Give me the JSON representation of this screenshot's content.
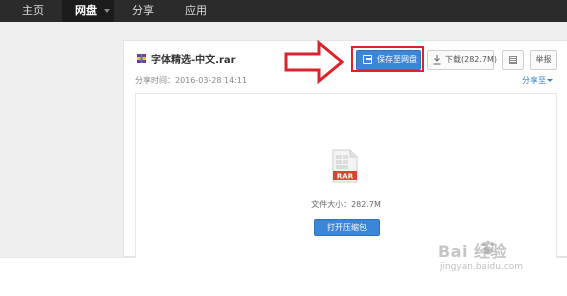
{
  "nav": {
    "items": [
      {
        "label": "主页"
      },
      {
        "label": "网盘"
      },
      {
        "label": "分享"
      },
      {
        "label": "应用"
      }
    ]
  },
  "file": {
    "name": "字体精选-中文.rar",
    "share_time": "分享时间：2016-03-28 14:11",
    "share_to": "分享至",
    "type_label": "RAR",
    "size_text": "文件大小：282.7M"
  },
  "actions": {
    "save": "保存至网盘",
    "download": "下载(282.7M)",
    "report": "举报",
    "open": "打开压缩包"
  },
  "colors": {
    "accent": "#3b86d8",
    "highlight": "#e0202a",
    "nav_bg": "#2b2b2b",
    "rar_red": "#d9452f"
  },
  "watermark": {
    "brand": "Bai 经验",
    "url": "jingyan.baidu.com"
  }
}
